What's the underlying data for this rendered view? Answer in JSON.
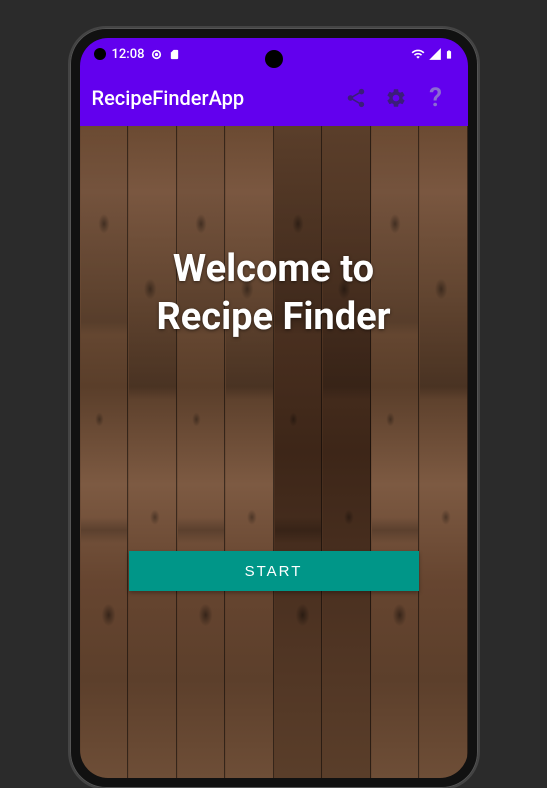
{
  "status": {
    "time": "12:08",
    "wifi": true,
    "battery": true
  },
  "appbar": {
    "title": "RecipeFinderApp"
  },
  "main": {
    "welcome_text": "Welcome to\nRecipe Finder",
    "start_button": "START"
  },
  "colors": {
    "primary": "#6200ee",
    "accent": "#009688"
  }
}
